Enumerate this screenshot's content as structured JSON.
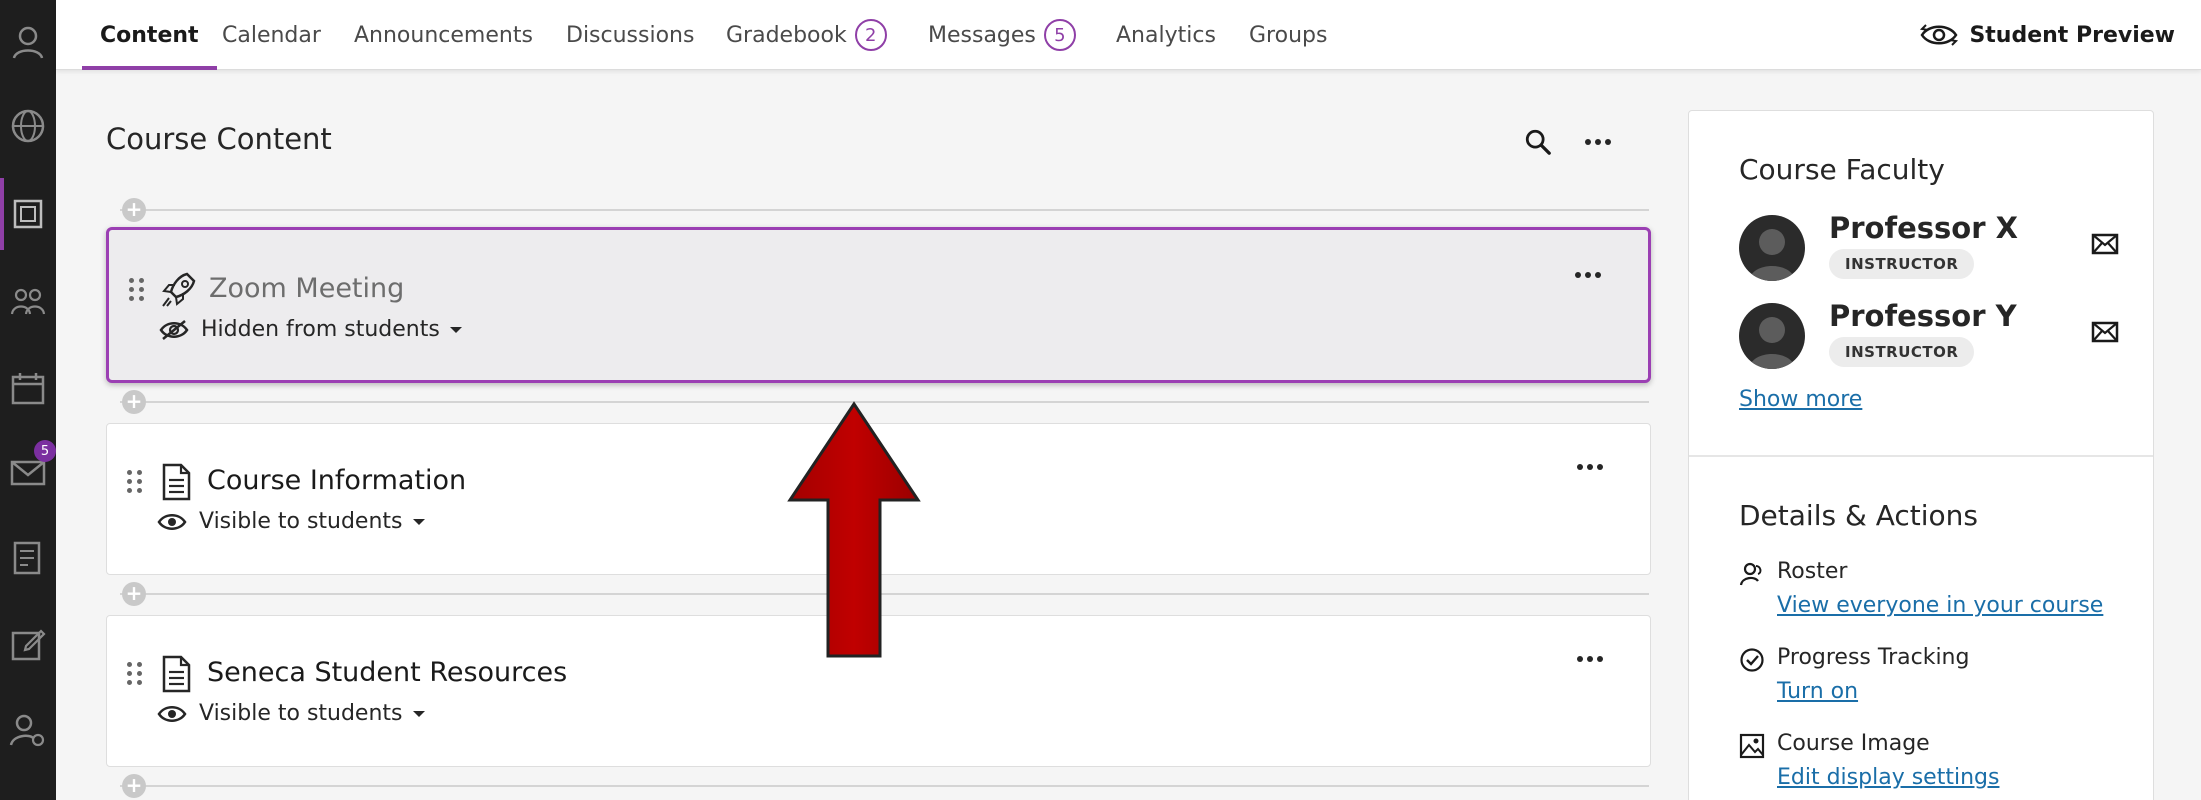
{
  "rail": {
    "items": [
      {
        "icon": "user-icon"
      },
      {
        "icon": "globe-icon"
      },
      {
        "icon": "courses-icon"
      },
      {
        "icon": "groups-icon"
      },
      {
        "icon": "calendar-icon"
      },
      {
        "icon": "messages-icon",
        "badge": "5"
      },
      {
        "icon": "grades-icon"
      },
      {
        "icon": "edit-icon"
      },
      {
        "icon": "user-settings-icon"
      }
    ]
  },
  "nav": {
    "tabs": [
      {
        "label": "Content"
      },
      {
        "label": "Calendar"
      },
      {
        "label": "Announcements"
      },
      {
        "label": "Discussions"
      },
      {
        "label": "Gradebook",
        "count": "2"
      },
      {
        "label": "Messages",
        "count": "5"
      },
      {
        "label": "Analytics"
      },
      {
        "label": "Groups"
      }
    ],
    "student_preview": "Student Preview"
  },
  "content": {
    "title": "Course Content",
    "items": [
      {
        "title": "Zoom Meeting",
        "icon": "rocket-icon",
        "visibility": "Hidden from students"
      },
      {
        "title": "Course Information",
        "icon": "document-icon",
        "visibility": "Visible to students"
      },
      {
        "title": "Seneca Student Resources",
        "icon": "document-icon",
        "visibility": "Visible to students"
      }
    ]
  },
  "side": {
    "faculty_heading": "Course Faculty",
    "faculty": [
      {
        "name": "Professor X",
        "role": "INSTRUCTOR"
      },
      {
        "name": "Professor Y",
        "role": "INSTRUCTOR"
      }
    ],
    "show_more": "Show more",
    "details_heading": "Details & Actions",
    "actions": [
      {
        "label": "Roster",
        "link": "View everyone in your course",
        "icon": "roster-icon"
      },
      {
        "label": "Progress Tracking",
        "link": "Turn on",
        "icon": "check-circle-icon"
      },
      {
        "label": "Course Image",
        "link": "Edit display settings",
        "icon": "image-icon"
      }
    ]
  },
  "colors": {
    "accent": "#8f3fa7",
    "arrow": "#c00000",
    "link": "#1a6ea8",
    "rail": "#1e1e1e"
  }
}
